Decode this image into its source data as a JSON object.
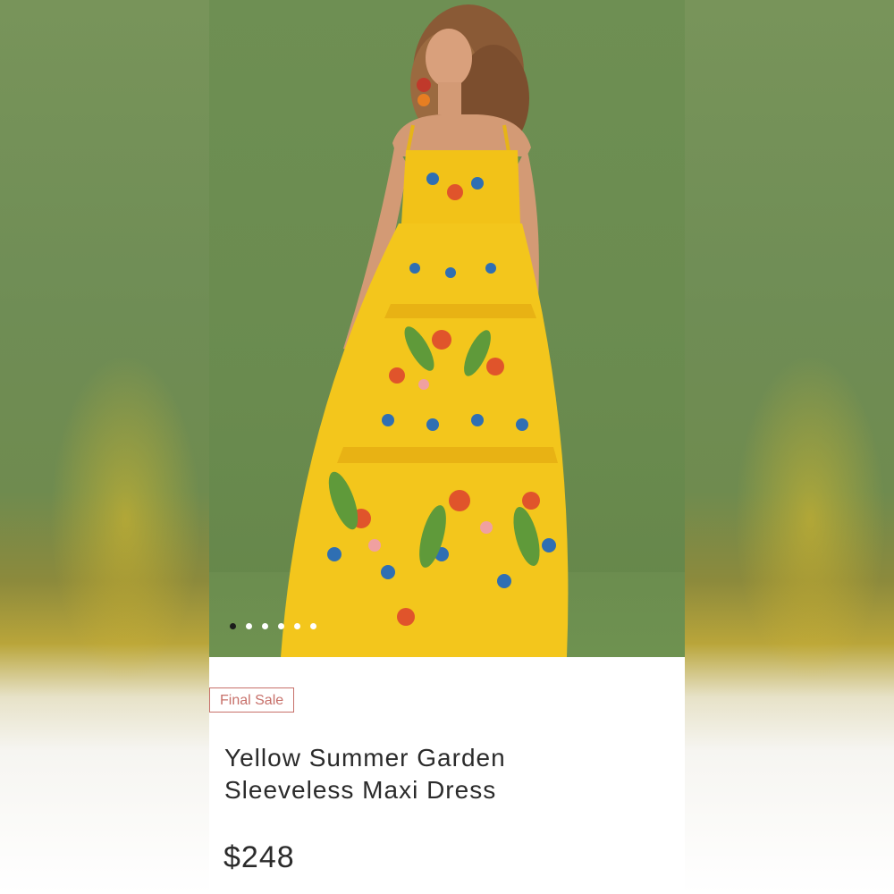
{
  "product": {
    "badge": "Final Sale",
    "title_line1": "Yellow Summer Garden",
    "title_line2": "Sleeveless Maxi Dress",
    "price": "$248"
  },
  "gallery": {
    "image_description_icon": "dress-photo",
    "dot_count": 6,
    "active_dot": 1
  },
  "colors": {
    "badge_accent": "#c7706a",
    "text": "#2b2b2b",
    "photo_background": "#6e8f53",
    "dress_yellow": "#f2c218"
  }
}
